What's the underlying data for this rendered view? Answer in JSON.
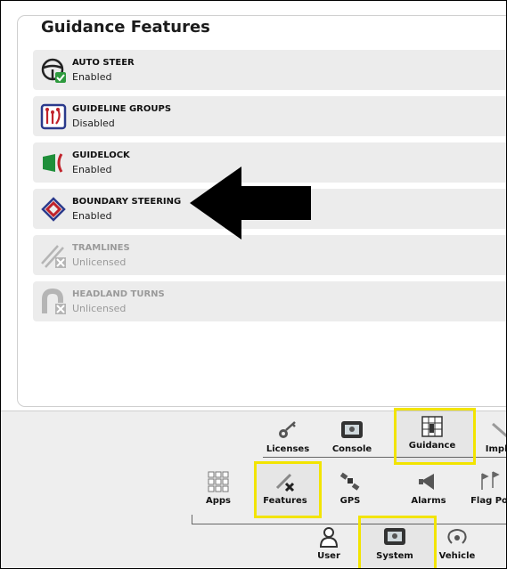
{
  "panel": {
    "title": "Guidance Features",
    "items": [
      {
        "name": "AUTO STEER",
        "status": "Enabled",
        "icon": "steering-wheel-icon"
      },
      {
        "name": "GUIDELINE GROUPS",
        "status": "Disabled",
        "icon": "guideline-groups-icon"
      },
      {
        "name": "GUIDELOCK",
        "status": "Enabled",
        "icon": "guidelock-icon"
      },
      {
        "name": "BOUNDARY STEERING",
        "status": "Enabled",
        "icon": "boundary-steering-icon"
      },
      {
        "name": "TRAMLINES",
        "status": "Unlicensed",
        "icon": "tramlines-icon"
      },
      {
        "name": "HEADLAND TURNS",
        "status": "Unlicensed",
        "icon": "headland-turns-icon"
      }
    ]
  },
  "nav": {
    "row1": [
      {
        "label": "Licenses",
        "icon": "keys-icon"
      },
      {
        "label": "Console",
        "icon": "console-icon"
      },
      {
        "label": "Guidance",
        "icon": "guidance-grid-icon"
      },
      {
        "label": "Impler",
        "icon": "implement-icon"
      }
    ],
    "row2": [
      {
        "label": "Apps",
        "icon": "apps-grid-icon"
      },
      {
        "label": "Features",
        "icon": "features-icon"
      },
      {
        "label": "GPS",
        "icon": "satellite-icon"
      },
      {
        "label": "Alarms",
        "icon": "alarm-horn-icon"
      },
      {
        "label": "Flag Po",
        "icon": "flag-points-icon"
      }
    ],
    "row3": [
      {
        "label": "User",
        "icon": "user-icon"
      },
      {
        "label": "System",
        "icon": "system-icon"
      },
      {
        "label": "Vehicle",
        "icon": "vehicle-icon"
      }
    ],
    "highlight_color": "#f2e400"
  }
}
